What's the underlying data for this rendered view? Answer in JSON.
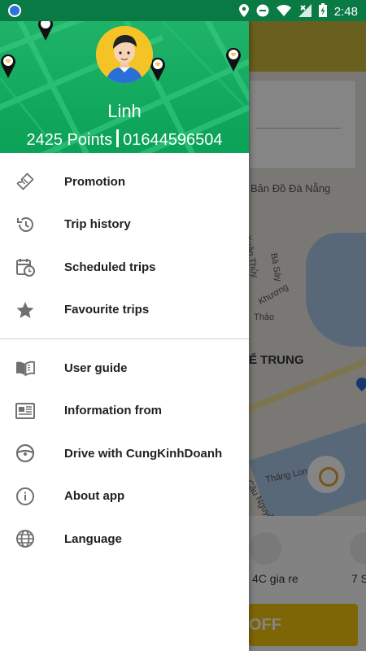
{
  "status_bar": {
    "time": "2:48",
    "icons": [
      "location-icon",
      "do-not-disturb-icon",
      "wifi-icon",
      "no-signal-icon",
      "battery-charging-icon"
    ]
  },
  "drawer": {
    "user": {
      "name": "Linh",
      "points": "2425 Points",
      "phone": "01644596504"
    },
    "menu_groups": [
      [
        {
          "label": "Promotion",
          "icon": "ticket-icon"
        },
        {
          "label": "Trip history",
          "icon": "history-icon"
        },
        {
          "label": "Scheduled trips",
          "icon": "calendar-clock-icon"
        },
        {
          "label": "Favourite trips",
          "icon": "star-icon"
        }
      ],
      [
        {
          "label": "User guide",
          "icon": "book-icon"
        },
        {
          "label": "Information from",
          "icon": "newspaper-icon"
        },
        {
          "label": "Drive with CungKinhDoanh",
          "icon": "steering-wheel-icon"
        },
        {
          "label": "About app",
          "icon": "info-icon"
        },
        {
          "label": "Language",
          "icon": "globe-icon"
        }
      ]
    ]
  },
  "background_map": {
    "labels": [
      "Bản Đồ Đà Nẵng",
      "Xuân Thủy",
      "Bà Sáy",
      "Khương",
      "Thảo",
      "Ế TRUNG",
      "Thăng Long",
      "Cầu Nguyễn"
    ],
    "car_labels": [
      "4C gia re",
      "7 S"
    ],
    "book_button": "OFF"
  },
  "colors": {
    "header_green": "#0aa257",
    "status_green": "#0a7a45",
    "avatar_yellow": "#f5c326",
    "icon_gray": "#707070"
  }
}
